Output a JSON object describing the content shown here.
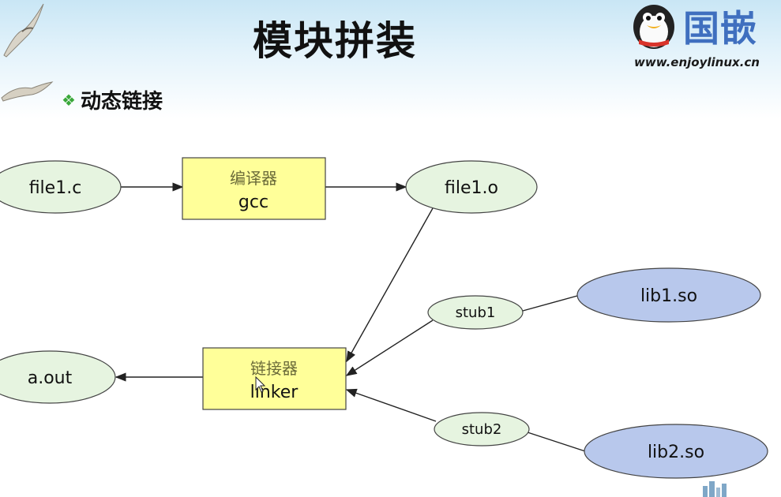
{
  "page": {
    "title": "模块拼装",
    "subtitle": "动态链接",
    "logo_text": "国嵌",
    "logo_url": "www.enjoylinux.cn"
  },
  "diagram": {
    "nodes": {
      "file1_c": "file1.c",
      "compiler_cn": "编译器",
      "compiler_en": "gcc",
      "file1_o": "file1.o",
      "stub1": "stub1",
      "lib1": "lib1.so",
      "linker_cn": "链接器",
      "linker_en": "linker",
      "a_out": "a.out",
      "stub2": "stub2",
      "lib2": "lib2.so"
    },
    "colors": {
      "green_node": "#e6f4e0",
      "blue_node": "#b8c8ec",
      "box": "#ffff99",
      "stroke": "#444444"
    }
  }
}
